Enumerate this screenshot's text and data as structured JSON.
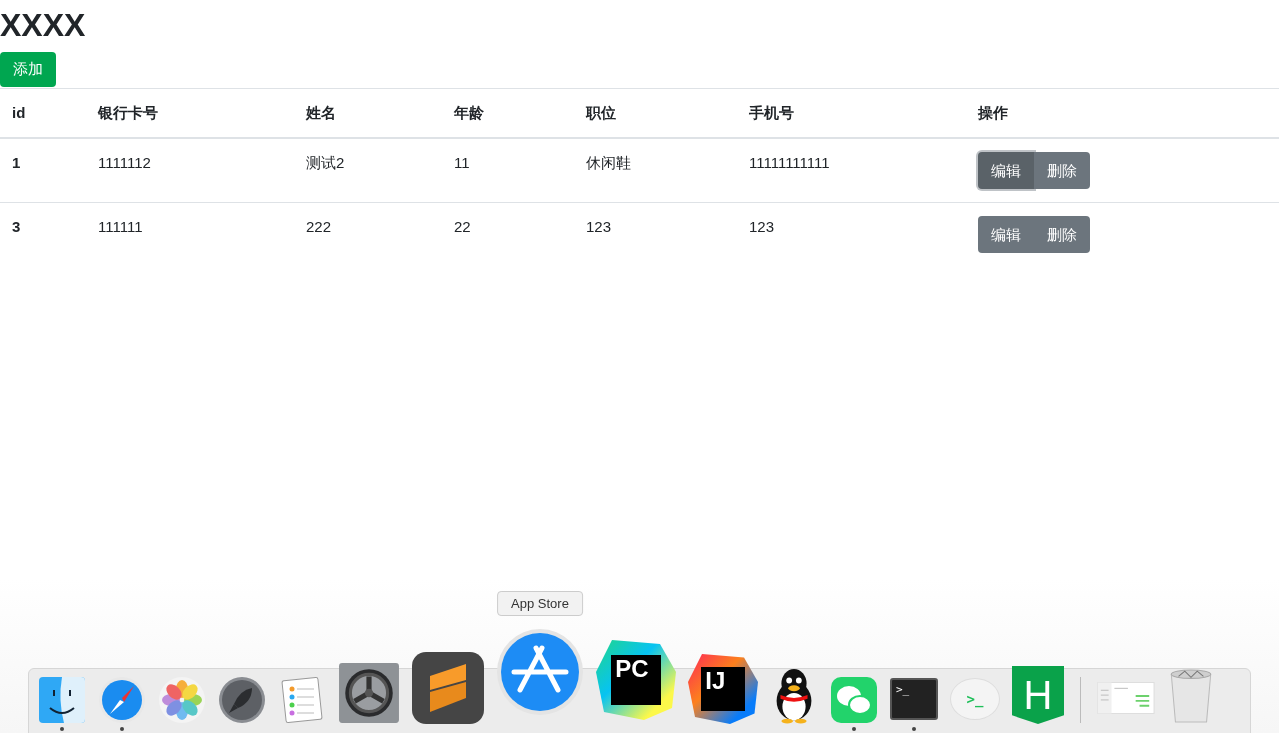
{
  "page": {
    "title": "XXXX",
    "add_button": "添加"
  },
  "table": {
    "columns": [
      "id",
      "银行卡号",
      "姓名",
      "年龄",
      "职位",
      "手机号",
      "操作"
    ],
    "rows": [
      {
        "cells": [
          "1",
          "1111112",
          "测试2",
          "11",
          "休闲鞋",
          "11111111111"
        ],
        "actions": [
          {
            "label": "编辑",
            "focused": true
          },
          {
            "label": "删除",
            "focused": false
          }
        ]
      },
      {
        "cells": [
          "3",
          "111111",
          "222",
          "22",
          "123",
          "123"
        ],
        "actions": [
          {
            "label": "编辑",
            "focused": false
          },
          {
            "label": "删除",
            "focused": false
          }
        ]
      }
    ]
  },
  "dock": {
    "items": [
      {
        "kind": "finder",
        "running": true
      },
      {
        "kind": "safari",
        "running": true
      },
      {
        "kind": "photos",
        "running": false
      },
      {
        "kind": "launchpad",
        "running": false
      },
      {
        "kind": "reminders",
        "running": false
      },
      {
        "kind": "preferences",
        "running": false
      },
      {
        "kind": "sublime",
        "running": false
      },
      {
        "kind": "appstore",
        "running": false,
        "tooltip": "App Store"
      },
      {
        "kind": "pycharm",
        "running": false,
        "glyph": "PC"
      },
      {
        "kind": "intellij",
        "running": false,
        "glyph": "IJ"
      },
      {
        "kind": "qq",
        "running": false
      },
      {
        "kind": "wechat",
        "running": true
      },
      {
        "kind": "terminal",
        "running": true,
        "glyph": ">_"
      },
      {
        "kind": "bubble",
        "running": false,
        "glyph": ">_"
      },
      {
        "kind": "hbuilder",
        "running": false,
        "glyph": "H"
      },
      {
        "kind": "separator"
      },
      {
        "kind": "screenshot",
        "running": false
      },
      {
        "kind": "trash",
        "running": false
      }
    ]
  }
}
